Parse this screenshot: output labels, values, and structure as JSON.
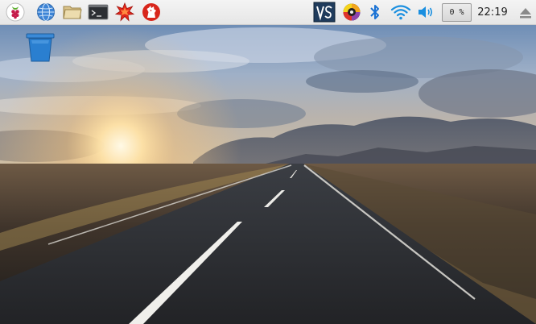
{
  "taskbar": {
    "launchers": [
      {
        "name": "raspberry-menu",
        "icon": "raspberry-icon"
      },
      {
        "name": "web-browser",
        "icon": "globe-icon"
      },
      {
        "name": "file-manager",
        "icon": "folder-icon"
      },
      {
        "name": "terminal",
        "icon": "terminal-icon"
      },
      {
        "name": "mathematica",
        "icon": "mathematica-icon"
      },
      {
        "name": "wolfram",
        "icon": "wolfram-icon"
      }
    ],
    "tray": {
      "vnc": "vnc-icon",
      "updater": "updater-icon",
      "bluetooth": "bluetooth-icon",
      "wifi": "wifi-icon",
      "volume": "volume-icon",
      "cpu_usage": "0 %",
      "clock": "22:19",
      "eject": "eject-icon"
    }
  },
  "desktop": {
    "icons": [
      {
        "name": "trash",
        "icon": "trash-icon"
      }
    ],
    "wallpaper": "road-sunset-wallpaper"
  },
  "colors": {
    "taskbar_bg": "#eeeeee",
    "raspberry": "#c51a4a",
    "vnc_bg": "#1f3b5c",
    "bluetooth": "#1a72d4",
    "wifi": "#1a8fe0",
    "trash": "#2a7fd0"
  }
}
